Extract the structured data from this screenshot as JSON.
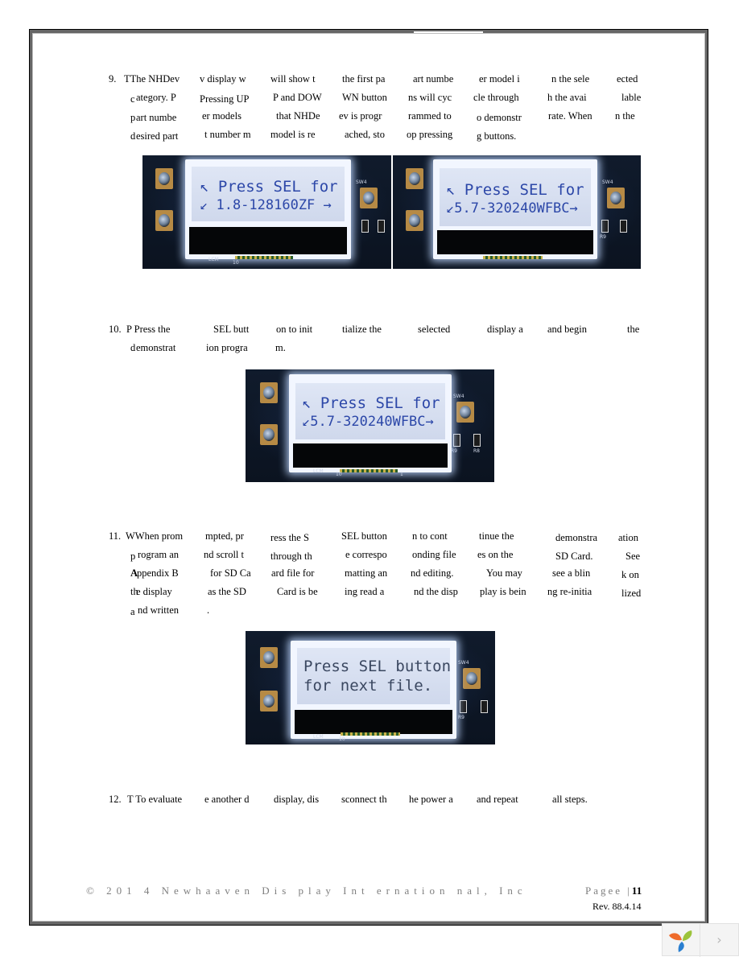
{
  "document": {
    "steps": [
      {
        "number": "9.",
        "lines": [
          [
            "TThe NHDev",
            "v display w",
            "will show t",
            "the first pa",
            "art numbe",
            "er model i",
            "n the sele",
            "ected"
          ],
          [
            "c",
            "ategory.  P",
            "Pressing UP",
            "P and DOW",
            "WN button",
            "ns will cyc",
            "cle through",
            "h the avai",
            "lable"
          ],
          [
            "p",
            "art numbe",
            "er models",
            "that NHDe",
            "ev is progr",
            "rammed to",
            "o demonstr",
            "rate. When",
            "n the"
          ],
          [
            "d",
            "esired part",
            "t number m",
            "model is re",
            "ached, sto",
            "op pressing",
            "g buttons."
          ]
        ]
      },
      {
        "number": "10.",
        "lines": [
          [
            "P Press the",
            "SEL butt",
            "on to init",
            "tialize the",
            "selected",
            "display  a",
            "and begin",
            "the"
          ],
          [
            "d",
            "emonstrat",
            "ion progra",
            "m."
          ]
        ]
      },
      {
        "number": "11.",
        "lines": [
          [
            "WWhen prom",
            "mpted, pr",
            "ress the S",
            "SEL button",
            "n to cont",
            "tinue the",
            "demonstra",
            "ation"
          ],
          [
            "p",
            "rogram an",
            "nd scroll t",
            "through th",
            "e correspo",
            "onding file",
            "es on the",
            "SD Card.",
            "See"
          ],
          [
            "A",
            "ppendix B",
            "for SD Ca",
            "ard file for",
            "matting an",
            "nd editing.",
            "You may",
            "see a blin",
            "k on"
          ],
          [
            "th",
            "e display",
            "as the SD",
            "Card is be",
            "ing read a",
            "nd the disp",
            "play is bein",
            "ng re-initia",
            "lized"
          ],
          [
            "a",
            "nd written",
            "."
          ]
        ]
      },
      {
        "number": "12.",
        "lines": [
          [
            "T To evaluate",
            "e another d",
            "display, dis",
            "sconnect th",
            "he power a",
            "and repeat",
            "all steps."
          ]
        ]
      }
    ],
    "photos": [
      {
        "caption": "lcd-photo-1",
        "line1": "↖ Press SEL for",
        "line2": "↙ 1.8-128160ZF →"
      },
      {
        "caption": "lcd-photo-2",
        "line1": "↖ Press SEL for",
        "line2": "↙5.7-320240WFBC→"
      },
      {
        "caption": "lcd-photo-3",
        "line1": "↖ Press SEL for",
        "line2": "↙5.7-320240WFBC→"
      },
      {
        "caption": "lcd-photo-4",
        "line1": "Press SEL button",
        "line2": "for next file."
      }
    ],
    "silkscreen": {
      "sw4": "SW4",
      "lcm": "LCM",
      "pin10": "10",
      "pin1": "1",
      "r9": "R9",
      "r8": "R8"
    },
    "footer": {
      "copyright": "©  201 4 Newhaaven Dis  play Int ernation nal, Inc",
      "page_label": "Pagee  |",
      "page_number": "11",
      "revision": "Rev. 88.4.14"
    }
  },
  "widget": {
    "logo_icon": "pinwheel-logo-icon",
    "next_label": "›"
  },
  "colors": {
    "lcd_text": "#2c47a8",
    "footer_gray": "#7f7f7f",
    "frame": "#666666"
  }
}
